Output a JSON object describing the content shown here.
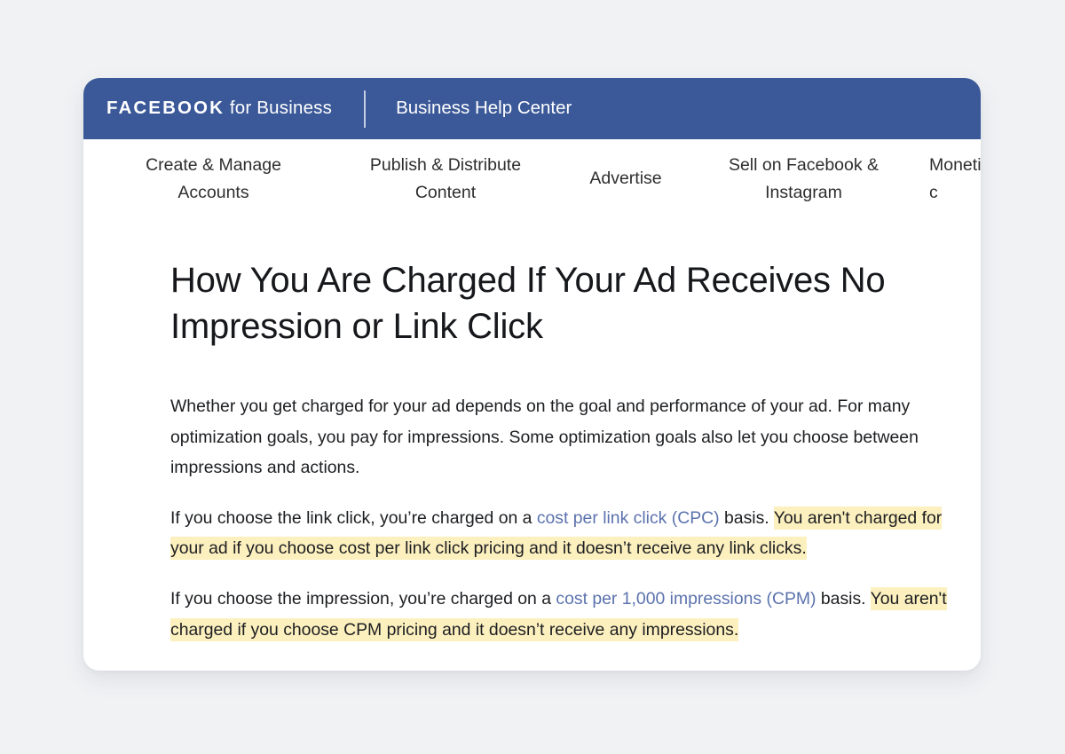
{
  "page": {
    "background_color": "#f1f2f4"
  },
  "card": {
    "background_color": "#ffffff"
  },
  "header": {
    "background_color": "#3b5998",
    "brand_bold": "FACEBOOK",
    "brand_regular": " for Business",
    "site_title": "Business Help Center"
  },
  "nav": {
    "items": [
      {
        "line1": "Create & Manage",
        "line2": "Accounts"
      },
      {
        "line1": "Publish & Distribute",
        "line2": "Content"
      },
      {
        "line1": "Advertise",
        "line2": ""
      },
      {
        "line1": "Sell on Facebook &",
        "line2": "Instagram"
      },
      {
        "line1": "Monetize",
        "line2": "c"
      }
    ]
  },
  "article": {
    "title": "How You Are Charged If Your Ad Receives No Impression or Link Click",
    "paragraph1": "Whether you get charged for your ad depends on the goal and performance of your ad. For many optimization goals, you pay for impressions. Some optimization goals also let you choose between impressions and actions.",
    "paragraph2": {
      "lead": "If you choose the link click, you’re charged on a ",
      "link": "cost per link click (CPC)",
      "after_link": " basis. ",
      "highlight": "You aren't charged for your ad if you choose cost per link click pricing and it doesn’t receive any link clicks."
    },
    "paragraph3": {
      "lead": "If you choose the impression, you’re charged on a ",
      "link": "cost per 1,000 impressions (CPM)",
      "after_link": " basis. ",
      "highlight": "You aren't charged if you choose CPM pricing and it doesn’t receive any impressions."
    },
    "link_color": "#5b72ad",
    "highlight_color": "#fdf0bf",
    "text_color": "#1c1e21"
  }
}
